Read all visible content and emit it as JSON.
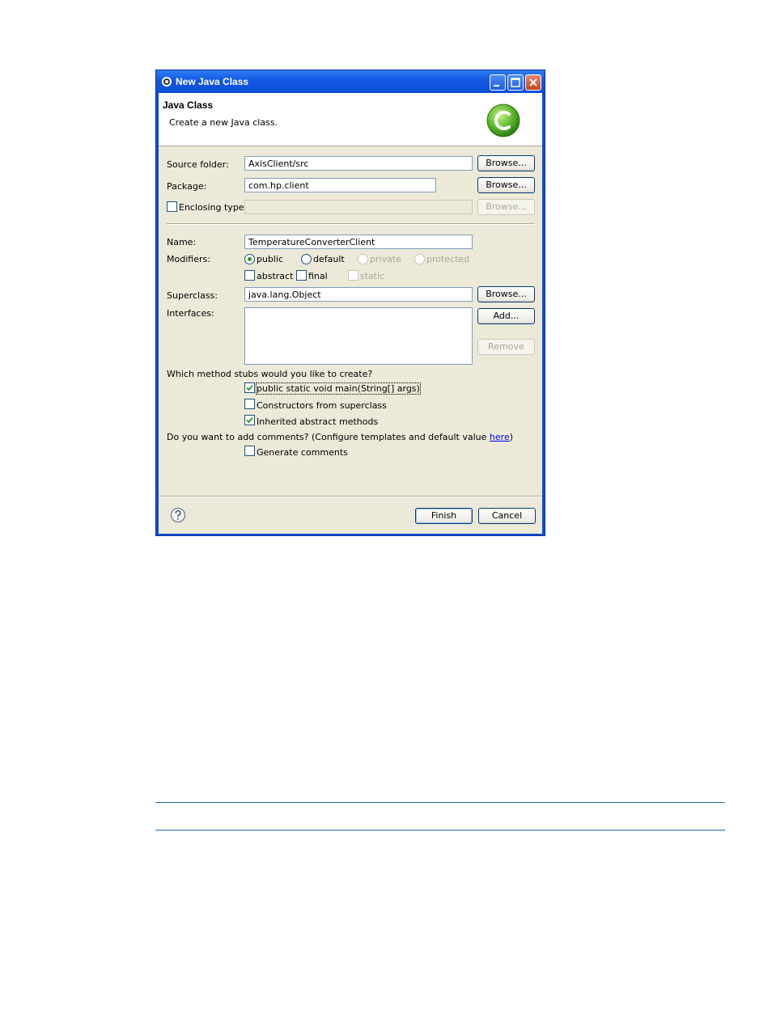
{
  "window": {
    "title": "New Java Class"
  },
  "header": {
    "title": "Java Class",
    "description": "Create a new Java class."
  },
  "source_folder": {
    "label": "Source folder:",
    "value": "AxisClient/src",
    "browse_label": "Browse..."
  },
  "package": {
    "label": "Package:",
    "value": "com.hp.client",
    "browse_label": "Browse..."
  },
  "enclosing_type": {
    "label": "Enclosing type:",
    "checked": false,
    "value": "",
    "browse_label": "Browse..."
  },
  "name": {
    "label": "Name:",
    "value": "TemperatureConverterClient"
  },
  "modifiers": {
    "label": "Modifiers:",
    "access": [
      {
        "label": "public",
        "selected": true,
        "enabled": true
      },
      {
        "label": "default",
        "selected": false,
        "enabled": true
      },
      {
        "label": "private",
        "selected": false,
        "enabled": false
      },
      {
        "label": "protected",
        "selected": false,
        "enabled": false
      }
    ],
    "flags": [
      {
        "label": "abstract",
        "checked": false,
        "enabled": true
      },
      {
        "label": "final",
        "checked": false,
        "enabled": true
      },
      {
        "label": "static",
        "checked": false,
        "enabled": false
      }
    ]
  },
  "superclass": {
    "label": "Superclass:",
    "value": "java.lang.Object",
    "browse_label": "Browse..."
  },
  "interfaces": {
    "label": "Interfaces:",
    "add_label": "Add...",
    "remove_label": "Remove"
  },
  "stubs": {
    "question": "Which method stubs would you like to create?",
    "options": [
      {
        "label": "public static void main(String[] args)",
        "checked": true
      },
      {
        "label": "Constructors from superclass",
        "checked": false
      },
      {
        "label": "Inherited abstract methods",
        "checked": true
      }
    ]
  },
  "comments": {
    "question": "Do you want to add comments? (Configure templates and default value ",
    "link": "here",
    "question_end": ")",
    "generate_label": "Generate comments",
    "generate_checked": false
  },
  "footer": {
    "finish_label": "Finish",
    "cancel_label": "Cancel",
    "help_icon": "help-icon"
  },
  "colors": {
    "titlebar": "#0c4fd8",
    "dialog_bg": "#ece9d8",
    "accent_green": "#21a121"
  }
}
